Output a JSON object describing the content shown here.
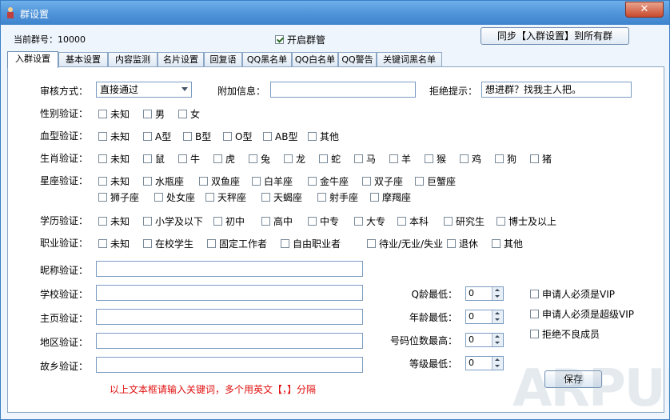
{
  "window": {
    "title": "群设置",
    "close_label": "✕"
  },
  "top": {
    "group_no_label": "当前群号：",
    "group_no": "10000",
    "enable_label": "开启群管",
    "enable_checked": true,
    "sync_label": "同步【入群设置】到所有群"
  },
  "tabs": [
    "入群设置",
    "基本设置",
    "内容监测",
    "名片设置",
    "回复语",
    "QQ黑名单",
    "QQ白名单",
    "QQ警告",
    "关键词黑名单"
  ],
  "audit": {
    "label": "审核方式：",
    "value": "直接通过",
    "extra_label": "附加信息：",
    "extra_value": "",
    "reject_label": "拒绝提示：",
    "reject_value": "想进群？找我主人把。"
  },
  "rows": {
    "gender": {
      "label": "性别验证：",
      "options": [
        "未知",
        "男",
        "女"
      ]
    },
    "blood": {
      "label": "血型验证：",
      "options": [
        "未知",
        "A型",
        "B型",
        "O型",
        "AB型",
        "其他"
      ]
    },
    "zodiac": {
      "label": "生肖验证：",
      "options": [
        "未知",
        "鼠",
        "牛",
        "虎",
        "兔",
        "龙",
        "蛇",
        "马",
        "羊",
        "猴",
        "鸡",
        "狗",
        "猪"
      ]
    },
    "star": {
      "label": "星座验证：",
      "options": [
        "未知",
        "水瓶座",
        "双鱼座",
        "白羊座",
        "金牛座",
        "双子座",
        "巨蟹座"
      ],
      "options2": [
        "狮子座",
        "处女座",
        "天秤座",
        "天蝎座",
        "射手座",
        "摩羯座"
      ]
    },
    "edu": {
      "label": "学历验证：",
      "options": [
        "未知",
        "小学及以下",
        "初中",
        "高中",
        "中专",
        "大专",
        "本科",
        "研究生",
        "博士及以上"
      ]
    },
    "job": {
      "label": "职业验证：",
      "options": [
        "未知",
        "在校学生",
        "固定工作者",
        "自由职业者",
        "待业/无业/失业",
        "退休",
        "其他"
      ]
    }
  },
  "text_fields": [
    {
      "label": "昵称验证：",
      "value": ""
    },
    {
      "label": "学校验证：",
      "value": ""
    },
    {
      "label": "主页验证：",
      "value": ""
    },
    {
      "label": "地区验证：",
      "value": ""
    },
    {
      "label": "故乡验证：",
      "value": ""
    }
  ],
  "spinners": [
    {
      "label": "Q龄最低：",
      "value": "0"
    },
    {
      "label": "年龄最低：",
      "value": "0"
    },
    {
      "label": "号码位数最高：",
      "value": "0"
    },
    {
      "label": "等级最低：",
      "value": "0"
    }
  ],
  "right_checks": [
    "申请人必须是VIP",
    "申请人必须是超级VIP",
    "拒绝不良成员"
  ],
  "save_label": "保存",
  "hint": "以上文本框请输入关键词，多个用英文【，】分隔",
  "watermark": "ARPUN",
  "colors": {
    "titlebar": "#4f93d8",
    "hint": "#e01010"
  }
}
